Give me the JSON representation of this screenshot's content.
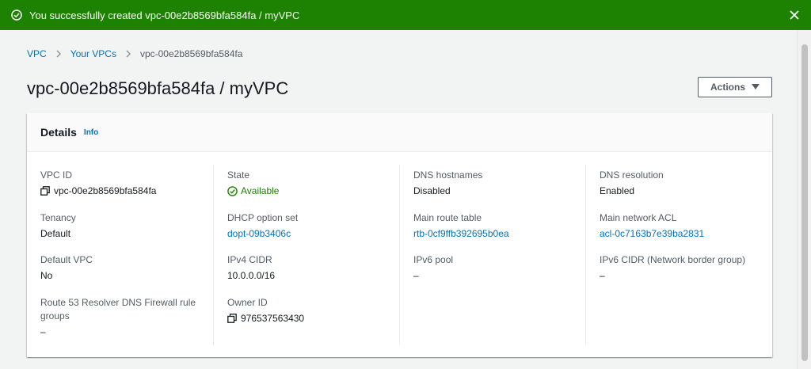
{
  "flash": {
    "message": "You successfully created vpc-00e2b8569bfa584fa / myVPC"
  },
  "breadcrumb": {
    "items": [
      "VPC",
      "Your VPCs"
    ],
    "current": "vpc-00e2b8569bfa584fa"
  },
  "page": {
    "title": "vpc-00e2b8569bfa584fa / myVPC",
    "actions_label": "Actions"
  },
  "details": {
    "title": "Details",
    "info_label": "Info",
    "columns": [
      [
        {
          "label": "VPC ID",
          "value": "vpc-00e2b8569bfa584fa"
        },
        {
          "label": "Tenancy",
          "value": "Default"
        },
        {
          "label": "Default VPC",
          "value": "No"
        },
        {
          "label": "Route 53 Resolver DNS Firewall rule groups",
          "value": "–"
        }
      ],
      [
        {
          "label": "State",
          "value": "Available"
        },
        {
          "label": "DHCP option set",
          "value": "dopt-09b3406c"
        },
        {
          "label": "IPv4 CIDR",
          "value": "10.0.0.0/16"
        },
        {
          "label": "Owner ID",
          "value": "976537563430"
        }
      ],
      [
        {
          "label": "DNS hostnames",
          "value": "Disabled"
        },
        {
          "label": "Main route table",
          "value": "rtb-0cf9ffb392695b0ea"
        },
        {
          "label": "IPv6 pool",
          "value": "–"
        }
      ],
      [
        {
          "label": "DNS resolution",
          "value": "Enabled"
        },
        {
          "label": "Main network ACL",
          "value": "acl-0c7163b7e39ba2831"
        },
        {
          "label": "IPv6 CIDR (Network border group)",
          "value": "–"
        }
      ]
    ]
  },
  "colors": {
    "success": "#1d8102",
    "link": "#0073bb",
    "label": "#545b64"
  },
  "icons": {
    "flash": "check-circle-icon",
    "close": "close-icon",
    "copy": "copy-icon",
    "state": "check-circle-icon"
  }
}
